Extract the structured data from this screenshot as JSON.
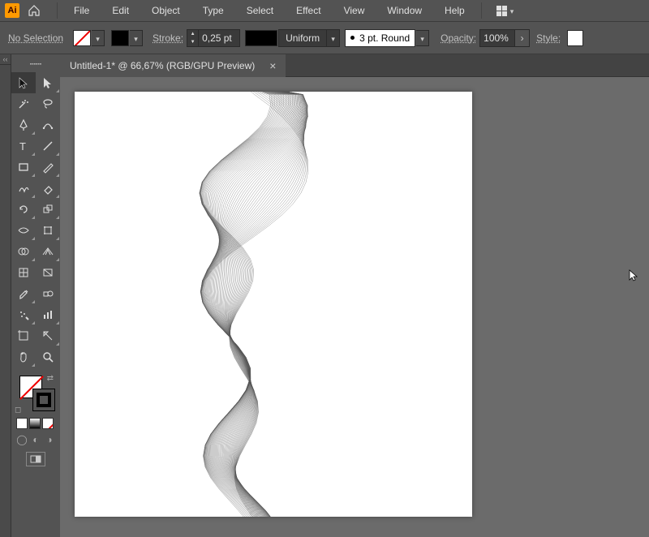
{
  "menubar": {
    "items": [
      "File",
      "Edit",
      "Object",
      "Type",
      "Select",
      "Effect",
      "View",
      "Window",
      "Help"
    ]
  },
  "controlbar": {
    "selection_label": "No Selection",
    "stroke_label": "Stroke:",
    "stroke_value": "0,25 pt",
    "profile_value": "Uniform",
    "brush_label": "3 pt. Round",
    "opacity_label": "Opacity:",
    "opacity_value": "100%",
    "style_label": "Style:"
  },
  "tab": {
    "title": "Untitled-1* @ 66,67% (RGB/GPU Preview)"
  },
  "tools": {
    "list": [
      [
        "selection",
        "direct-selection"
      ],
      [
        "magic-wand",
        "lasso"
      ],
      [
        "pen",
        "curvature"
      ],
      [
        "type",
        "line-segment"
      ],
      [
        "rectangle",
        "paintbrush"
      ],
      [
        "shaper",
        "eraser"
      ],
      [
        "rotate",
        "scale"
      ],
      [
        "width",
        "free-transform"
      ],
      [
        "shape-builder",
        "perspective"
      ],
      [
        "mesh",
        "gradient"
      ],
      [
        "eyedropper",
        "blend"
      ],
      [
        "symbol-sprayer",
        "column-graph"
      ],
      [
        "artboard",
        "slice"
      ],
      [
        "hand",
        "zoom"
      ]
    ],
    "modes": [
      "normal",
      "full"
    ]
  },
  "swatches": {
    "fill": "none",
    "stroke": "#000000",
    "row": [
      "#ffffff",
      "#000000",
      "none"
    ]
  },
  "icons": {
    "home": "home-icon",
    "layout": "layout-icon"
  }
}
